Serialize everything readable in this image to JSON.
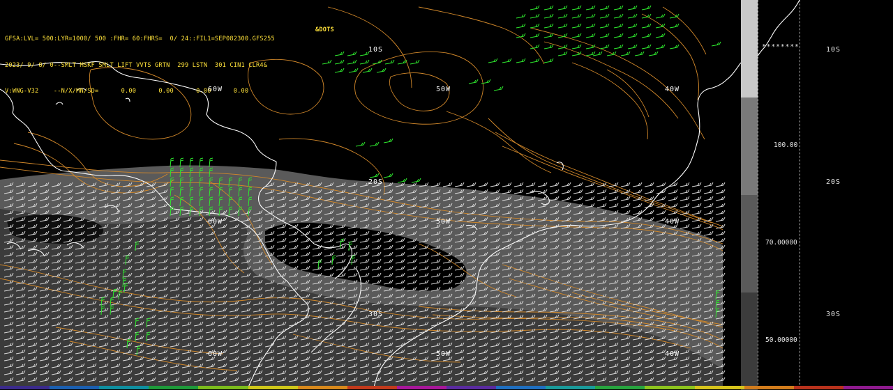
{
  "header": {
    "line1": "GFSA:LVL= 500:LYR=1000/ 500 :FHR= 60:FHRS=  0/ 24::FIL1=SEP082300.GFS255",
    "line2": "2023/ 9/ 8/ 0--SMLT MSKF SMLT LIFT VVTS GRTN  299 LSTN  301 CIN1 CLR4&",
    "line3": "V:WNG-V32    --N/X/MN/SD=      0.00      0.00      0.00      0.00",
    "dots": "&DOTS"
  },
  "map_labels": {
    "lat_10s": "10S",
    "lat_20s": "20S",
    "lat_30s": "30S",
    "lon_60w": "60W",
    "lon_50w": "50W",
    "lon_40w": "40W"
  },
  "side_panel": {
    "val_100": "100.00",
    "val_70": "70.00000",
    "val_50": "50.00000",
    "asterisks": "********",
    "lat_10s": "10S",
    "lat_20s": "20S",
    "lat_30s": "30S"
  },
  "colors": {
    "background": "#000000",
    "contour": "#d2882a",
    "coast": "#ffffff",
    "barb_green": "#2ee82e",
    "shade_light": "#5a5a5a",
    "shade_dark": "#3a3a3a",
    "header_text": "#ffe23a"
  },
  "colorbar": [
    "#c8c8c8",
    "#7a7a7a",
    "#5a5a5a",
    "#3c3c3c"
  ],
  "bottom_strip": [
    "#3b2a8c",
    "#1b5fb0",
    "#0f8fa0",
    "#1e9a3a",
    "#7cbc1c",
    "#cfc71a",
    "#d8891c",
    "#c23a1c",
    "#a8179a",
    "#5a2ba0",
    "#1f6fc0",
    "#1a9b9b",
    "#27a43f",
    "#8ec41e",
    "#d7c41c",
    "#d27c1c",
    "#b8321c",
    "#8f1a8f"
  ]
}
